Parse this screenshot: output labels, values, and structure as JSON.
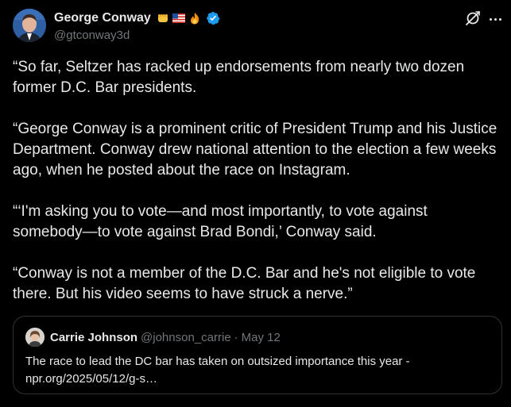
{
  "post": {
    "author_name": "George Conway",
    "author_emojis": [
      "fist-emoji",
      "us-flag-emoji",
      "fire-emoji"
    ],
    "author_handle": "@gtconway3d",
    "verified": true,
    "paragraphs": [
      "“So far, Seltzer has racked up endorsements from nearly two dozen former D.C. Bar presidents.",
      "“George Conway is a prominent critic of President Trump and his Justice Department. Conway drew national attention to the election a few weeks ago, when he posted about the race on Instagram.",
      "“‘I'm asking you to vote—and most importantly, to vote against somebody—to vote against Brad Bondi,’ Conway said.",
      "“Conway is not a member of the D.C. Bar and he's not eligible to vote there. But his video seems to have struck a nerve.”"
    ]
  },
  "quote": {
    "author_name": "Carrie Johnson",
    "author_handle": "@johnson_carrie",
    "separator": "·",
    "time": "May 12",
    "text_line1": "The race to lead the DC bar has taken on outsized importance this year -",
    "text_line2": "npr.org/2025/05/12/g-s…"
  },
  "colors": {
    "background": "#000000",
    "text_primary": "#e7e9ea",
    "text_secondary": "#71767b",
    "verified_blue": "#1d9bf0",
    "border": "#2f3336"
  }
}
